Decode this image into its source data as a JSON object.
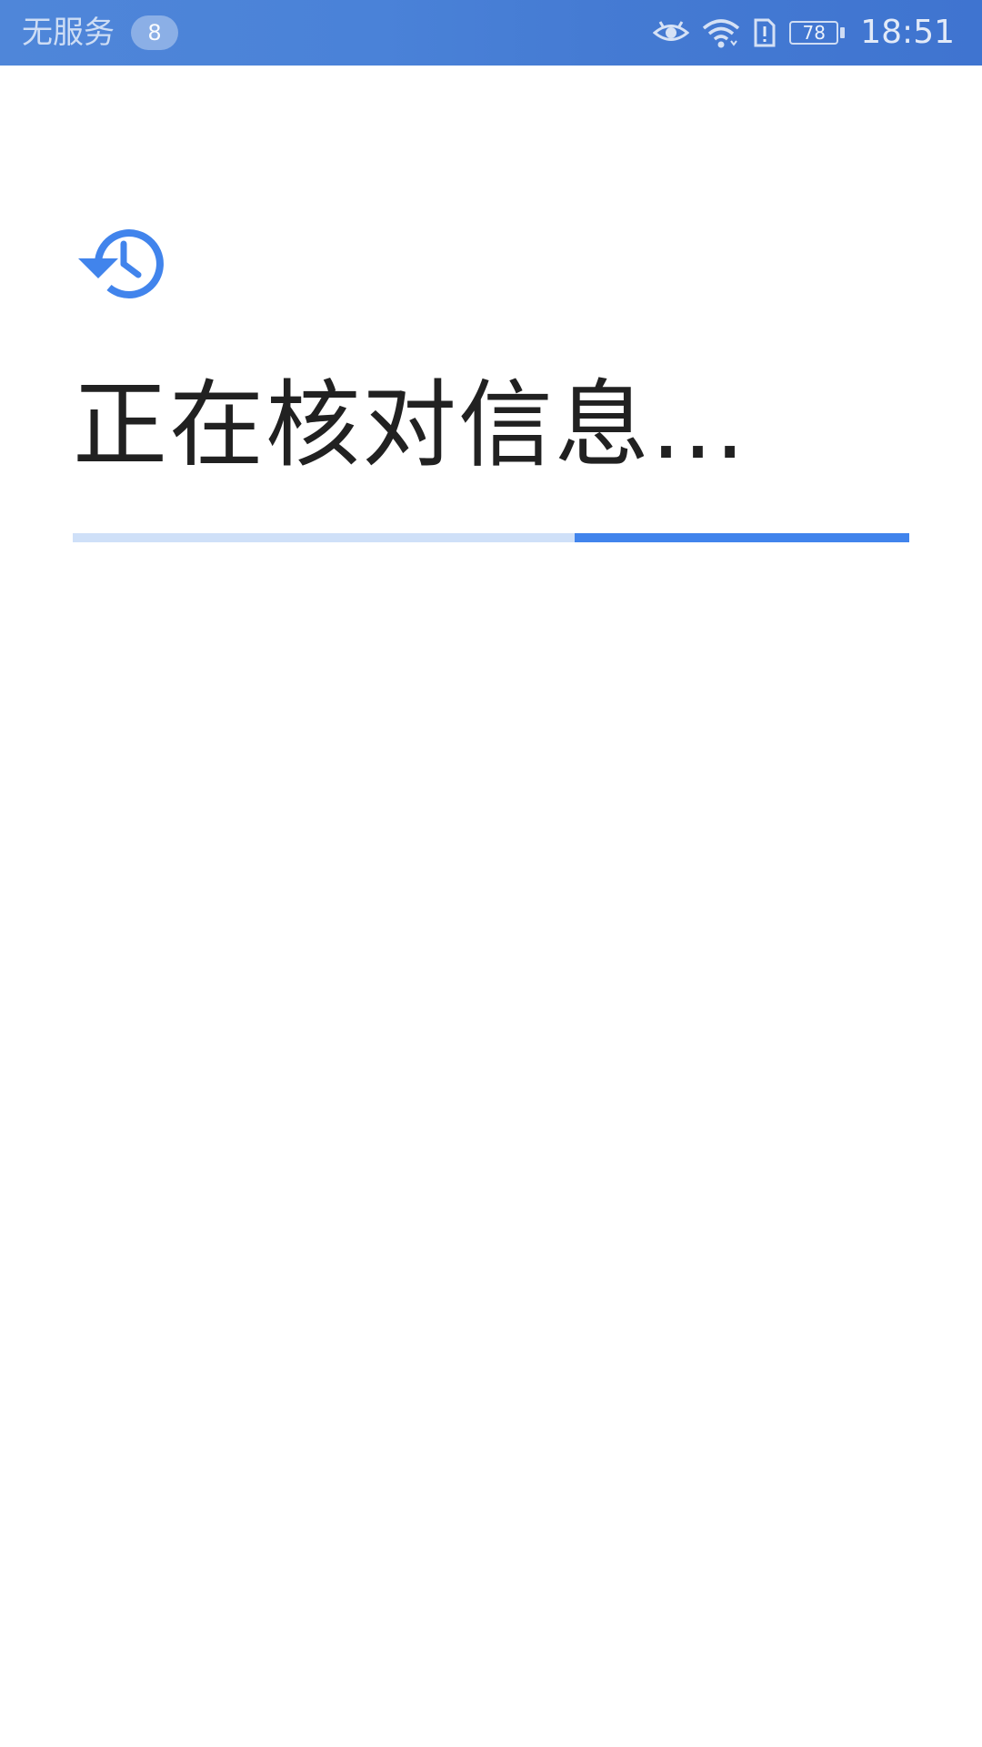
{
  "status_bar": {
    "carrier": "无服务",
    "notification_count": "8",
    "icons": [
      "eye-comfort-icon",
      "wifi-icon",
      "sim-alert-icon",
      "battery-icon"
    ],
    "battery_level": "78",
    "time": "18:51"
  },
  "main": {
    "icon": "history-icon",
    "title": "正在核对信息...",
    "progress": {
      "start_fraction": 0.6,
      "end_fraction": 1.0
    }
  },
  "colors": {
    "status_bar": "#4a82d8",
    "accent": "#4184ec",
    "progress_track": "#cfe0f8",
    "title_text": "#212121",
    "background": "#ffffff"
  }
}
